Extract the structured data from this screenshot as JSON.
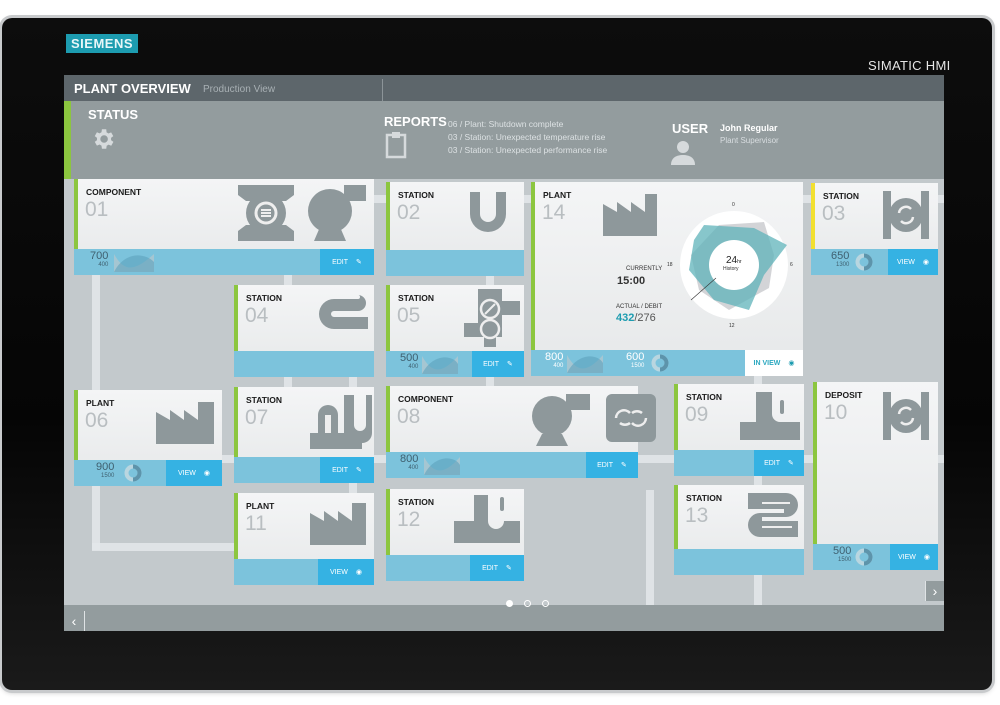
{
  "device": {
    "brand": "SIEMENS",
    "model": "SIMATIC HMI"
  },
  "topbar": {
    "title": "PLANT OVERVIEW",
    "subtitle": "Production View"
  },
  "header": {
    "status": {
      "label": "STATUS",
      "icon": "gear-icon"
    },
    "reports": {
      "label": "REPORTS",
      "icon": "clipboard-icon",
      "items": [
        "06 / Plant: Shutdown complete",
        "03 / Station: Unexpected temperature rise",
        "03 / Station: Unexpected performance rise"
      ]
    },
    "user": {
      "label": "USER",
      "name": "John Regular",
      "role": "Plant Supervisor",
      "icon": "user-icon"
    }
  },
  "cards": {
    "c01": {
      "type": "COMPONENT",
      "num": "01",
      "metric_top": "700",
      "metric_bottom": "400",
      "action": "EDIT",
      "accent": "#8cc63f"
    },
    "c02": {
      "type": "STATION",
      "num": "02"
    },
    "c14": {
      "type": "PLANT",
      "num": "14",
      "currently_label": "CURRENTLY",
      "currently_value": "15:00",
      "actual_label": "ACTUAL / DEBIT",
      "actual_value": "432",
      "debit_value": "/276",
      "gauge_center": "24",
      "gauge_unit": "hr",
      "gauge_caption": "History",
      "gauge_ticks": {
        "top": "0",
        "right": "6",
        "bottom": "12",
        "left": "18"
      },
      "metric1_top": "800",
      "metric1_bottom": "400",
      "metric2_top": "600",
      "metric2_bottom": "1500",
      "action": "IN VIEW"
    },
    "c03": {
      "type": "STATION",
      "num": "03",
      "metric_top": "650",
      "metric_bottom": "1300",
      "action": "VIEW",
      "accent": "#f2e030"
    },
    "c04": {
      "type": "STATION",
      "num": "04"
    },
    "c05": {
      "type": "STATION",
      "num": "05",
      "metric_top": "500",
      "metric_bottom": "400",
      "action": "EDIT"
    },
    "c06": {
      "type": "PLANT",
      "num": "06",
      "metric_top": "900",
      "metric_bottom": "1500",
      "action": "VIEW"
    },
    "c07": {
      "type": "STATION",
      "num": "07",
      "action": "EDIT"
    },
    "c08": {
      "type": "COMPONENT",
      "num": "08",
      "metric_top": "800",
      "metric_bottom": "400",
      "action": "EDIT"
    },
    "c09": {
      "type": "STATION",
      "num": "09",
      "action": "EDIT"
    },
    "c10": {
      "type": "DEPOSIT",
      "num": "10",
      "metric_top": "500",
      "metric_bottom": "1500",
      "action": "VIEW"
    },
    "c11": {
      "type": "PLANT",
      "num": "11",
      "action": "VIEW"
    },
    "c12": {
      "type": "STATION",
      "num": "12",
      "action": "EDIT"
    },
    "c13": {
      "type": "STATION",
      "num": "13"
    }
  },
  "pagination": {
    "current": 1,
    "total": 3
  },
  "nav": {
    "prev": "‹",
    "next": "›"
  }
}
